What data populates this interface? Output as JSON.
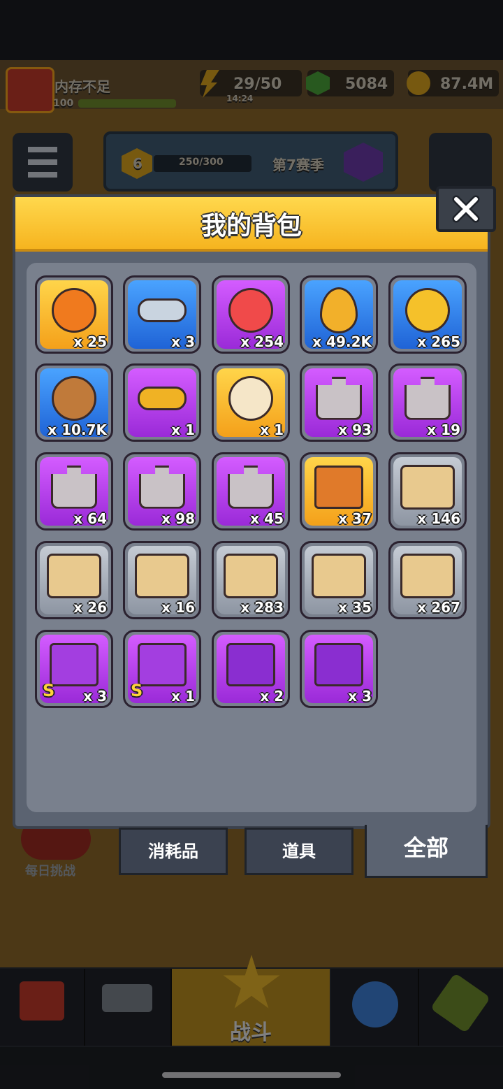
{
  "hud": {
    "status": "内存不足",
    "level": "100",
    "energy": "29/50",
    "timer": "14:24",
    "gems": "5084",
    "coins": "87.4M"
  },
  "season": {
    "rank": "6",
    "progress": "250/300",
    "progress_fraction": 0.833,
    "name": "第7赛季"
  },
  "side": {
    "daily_challenge": "每日挑战"
  },
  "modal": {
    "title": "我的背包",
    "items": [
      {
        "icon": "gold-dna-coin-icon",
        "rarity": "gold",
        "qty": "x 25"
      },
      {
        "icon": "silver-key-icon",
        "rarity": "blue",
        "qty": "x 3"
      },
      {
        "icon": "heart-orb-icon",
        "rarity": "purple",
        "qty": "x 254"
      },
      {
        "icon": "fire-drop-icon",
        "rarity": "blue",
        "qty": "x 49.2K"
      },
      {
        "icon": "gold-coin-icon",
        "rarity": "blue",
        "qty": "x 265"
      },
      {
        "icon": "dog-cookie-icon",
        "rarity": "blue",
        "qty": "x 10.7K"
      },
      {
        "icon": "gold-key-icon",
        "rarity": "purple",
        "qty": "x 1"
      },
      {
        "icon": "potion-icon",
        "rarity": "gold",
        "qty": "x 1"
      },
      {
        "icon": "hero-puzzle-icon",
        "rarity": "purple",
        "qty": "x 93"
      },
      {
        "icon": "hero-puzzle-icon",
        "rarity": "purple",
        "qty": "x 19"
      },
      {
        "icon": "hero-puzzle-icon",
        "rarity": "purple",
        "qty": "x 64"
      },
      {
        "icon": "hero-puzzle-icon",
        "rarity": "purple",
        "qty": "x 98"
      },
      {
        "icon": "hero-puzzle-icon",
        "rarity": "purple",
        "qty": "x 45"
      },
      {
        "icon": "chest-icon",
        "rarity": "gold",
        "qty": "x 37"
      },
      {
        "icon": "gun-scroll-icon",
        "rarity": "gray",
        "qty": "x 146"
      },
      {
        "icon": "armor-scroll-icon",
        "rarity": "gray",
        "qty": "x 26"
      },
      {
        "icon": "necklace-scroll-icon",
        "rarity": "gray",
        "qty": "x 16"
      },
      {
        "icon": "belt-scroll-icon",
        "rarity": "gray",
        "qty": "x 283"
      },
      {
        "icon": "glove-scroll-icon",
        "rarity": "gray",
        "qty": "x 35"
      },
      {
        "icon": "boots-scroll-icon",
        "rarity": "gray",
        "qty": "x 267"
      },
      {
        "icon": "s-chest-icon",
        "rarity": "purple",
        "qty": "x 3",
        "badge": "S"
      },
      {
        "icon": "s-heart-chest-icon",
        "rarity": "purple",
        "qty": "x 1",
        "badge": "S"
      },
      {
        "icon": "purple-chest-icon",
        "rarity": "purple",
        "qty": "x 2"
      },
      {
        "icon": "purple-chest-icon",
        "rarity": "purple",
        "qty": "x 3"
      }
    ]
  },
  "tabs": {
    "consumables": "消耗品",
    "props": "道具",
    "all": "全部"
  },
  "nav": {
    "battle": "战斗"
  },
  "colors": {
    "gold": "#f6b41f",
    "blue": "#2f7fe8",
    "purple": "#b43ee6",
    "gray": "#aab1bc",
    "panel": "#5b6371"
  }
}
